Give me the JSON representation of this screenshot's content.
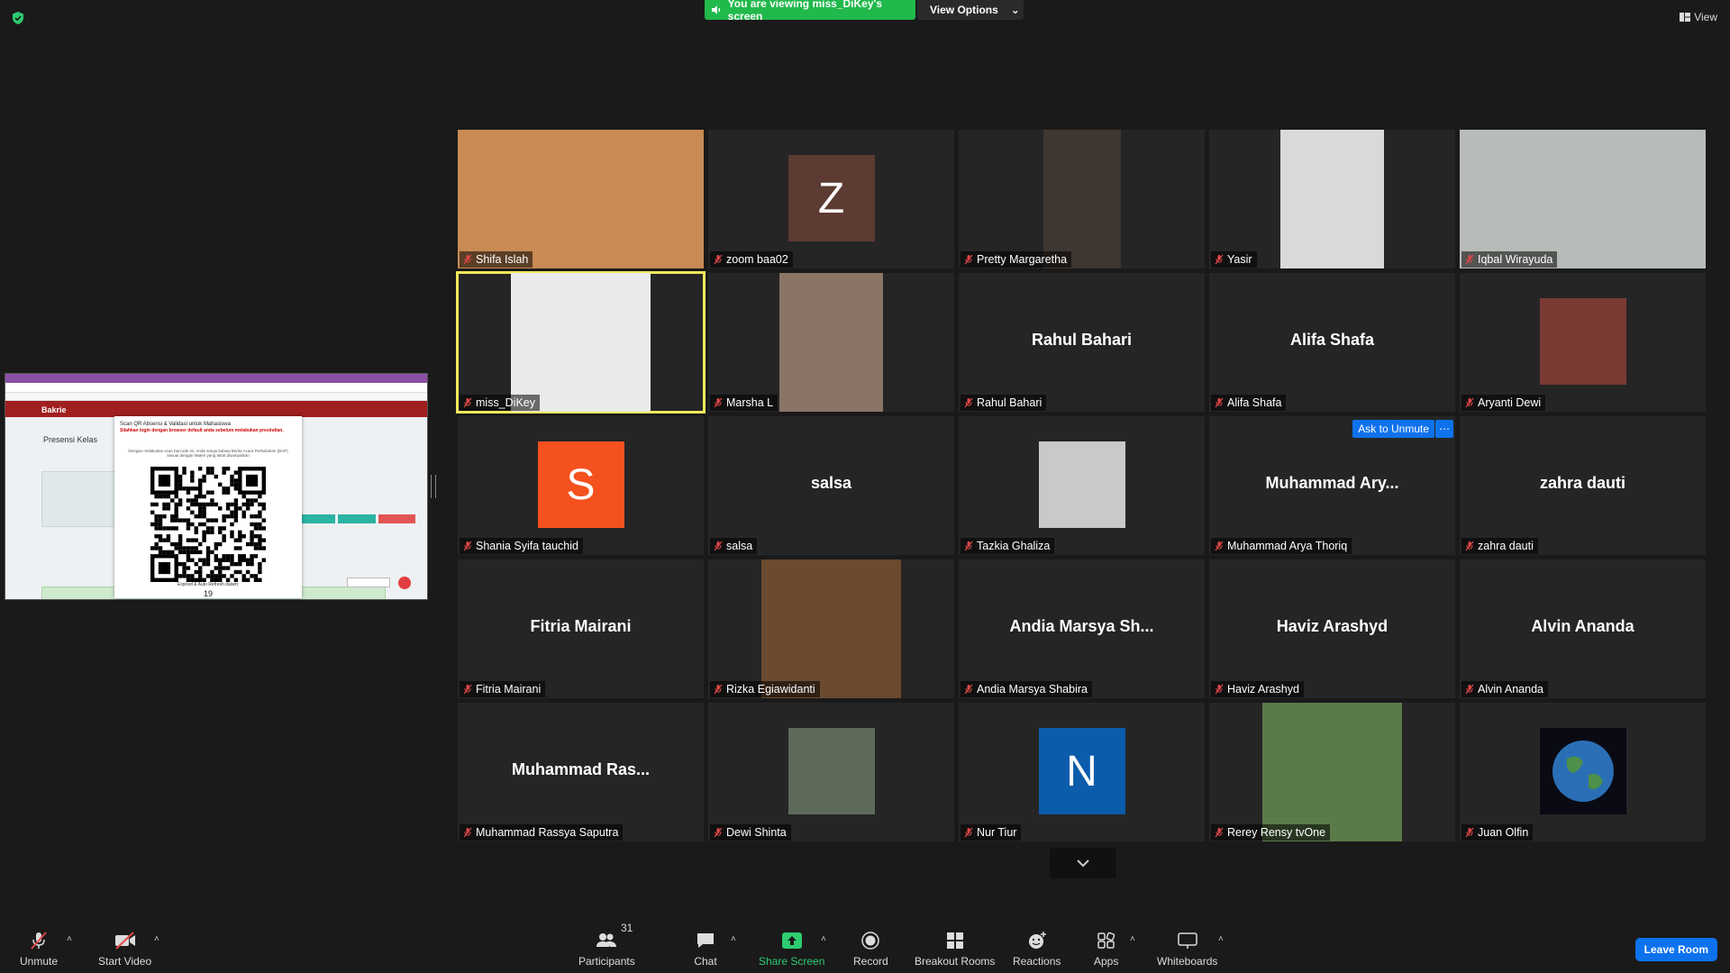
{
  "top": {
    "banner": "You are viewing miss_DiKey's screen",
    "view_options": "View Options",
    "view": "View"
  },
  "shared_screen": {
    "header": "Bakrie",
    "logo_text": "UNIVERSITAS BAKRIE",
    "page_title": "Presensi Kelas",
    "modal_title": "Scan QR Absensi & Validasi untuk Mahasiswa",
    "modal_warning": "Silahkan login dengan browser default anda sebelum melakukan presindian.",
    "modal_desc": "Dengan melakukan scan barcode ini, Anda setuju bahwa Berita Acara Perkuliahan (BAP) sesuai dengan Materi yang telah disampaikan",
    "modal_expire": "Expired & Auto Refresh dalam:",
    "modal_counter": "19"
  },
  "participants": [
    {
      "name": "Shifa Islah",
      "type": "video",
      "bg": "#c98a54"
    },
    {
      "name": "zoom baa02",
      "type": "avatar",
      "letter": "Z",
      "color": "#5c3b32"
    },
    {
      "name": "Pretty Margaretha",
      "type": "video",
      "bg": "#3e3630"
    },
    {
      "name": "Yasir",
      "type": "video",
      "bg": "#d9d9dc"
    },
    {
      "name": "Iqbal Wirayuda",
      "type": "video",
      "bg": "#b8bcb8"
    },
    {
      "name": "miss_DiKey",
      "type": "video",
      "bg": "#eaeaea",
      "speaking": true
    },
    {
      "name": "Marsha L",
      "type": "video",
      "bg": "#8a7466"
    },
    {
      "name": "Rahul Bahari",
      "type": "name",
      "display": "Rahul Bahari"
    },
    {
      "name": "Alifa Shafa",
      "type": "name",
      "display": "Alifa Shafa"
    },
    {
      "name": "Aryanti Dewi",
      "type": "photo",
      "bg": "#7a3a34"
    },
    {
      "name": "Shania Syifa tauchid",
      "type": "avatar",
      "letter": "S",
      "color": "#f4511e"
    },
    {
      "name": "salsa",
      "type": "name",
      "display": "salsa"
    },
    {
      "name": "Tazkia Ghaliza",
      "type": "photo",
      "bg": "#c9c9c9"
    },
    {
      "name": "Muhammad Arya Thoriq",
      "type": "name",
      "display": "Muhammad  Ary...",
      "ask_unmute": "Ask to Unmute"
    },
    {
      "name": "zahra dauti",
      "type": "name",
      "display": "zahra dauti"
    },
    {
      "name": "Fitria Mairani",
      "type": "name",
      "display": "Fitria Mairani"
    },
    {
      "name": "Rizka Egiawidanti",
      "type": "video",
      "bg": "#6b4a2f"
    },
    {
      "name": "Andia Marsya Shabira",
      "type": "name",
      "display": "Andia  Marsya  Sh..."
    },
    {
      "name": "Haviz Arashyd",
      "type": "name",
      "display": "Haviz Arashyd"
    },
    {
      "name": "Alvin Ananda",
      "type": "name",
      "display": "Alvin Ananda"
    },
    {
      "name": "Muhammad Rassya Saputra",
      "type": "name",
      "display": "Muhammad  Ras..."
    },
    {
      "name": "Dewi Shinta",
      "type": "photo",
      "bg": "#5d6a5a"
    },
    {
      "name": "Nur Tiur",
      "type": "avatar",
      "letter": "N",
      "color": "#0b5cab"
    },
    {
      "name": "Rerey Rensy tvOne",
      "type": "video",
      "bg": "#5a7a4a"
    },
    {
      "name": "Juan Olfin",
      "type": "globe"
    }
  ],
  "toolbar": {
    "unmute": "Unmute",
    "start_video": "Start Video",
    "participants": "Participants",
    "participants_count": "31",
    "chat": "Chat",
    "share_screen": "Share Screen",
    "record": "Record",
    "breakout_rooms": "Breakout Rooms",
    "reactions": "Reactions",
    "apps": "Apps",
    "whiteboards": "Whiteboards",
    "leave_room": "Leave Room"
  },
  "colors": {
    "accent_blue": "#0e72ed",
    "share_green": "#21b94c",
    "speaker_outline": "#f0e85a",
    "muted_red": "#e04848"
  }
}
